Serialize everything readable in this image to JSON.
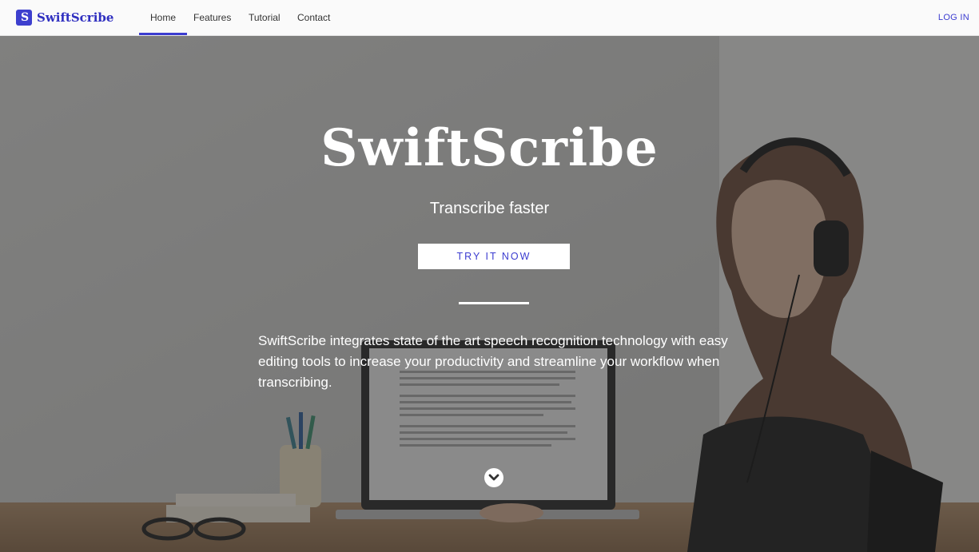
{
  "nav": {
    "brand_logo": "S",
    "brand": "SwiftScribe",
    "links": [
      "Home",
      "Features",
      "Tutorial",
      "Contact"
    ],
    "login": "LOG IN"
  },
  "hero": {
    "title": "SwiftScribe",
    "subtitle": "Transcribe faster",
    "cta": "TRY IT NOW",
    "description": "SwiftScribe integrates state of the art speech recognition technology with easy editing tools to increase your productivity and streamline your workflow when transcribing."
  },
  "colors": {
    "accent": "#3b3cd0",
    "overlay": "rgba(40,40,40,0.5)"
  },
  "icons": {
    "scroll": "chevron-down-circle-icon",
    "logo": "swiftscribe-logo-icon"
  }
}
